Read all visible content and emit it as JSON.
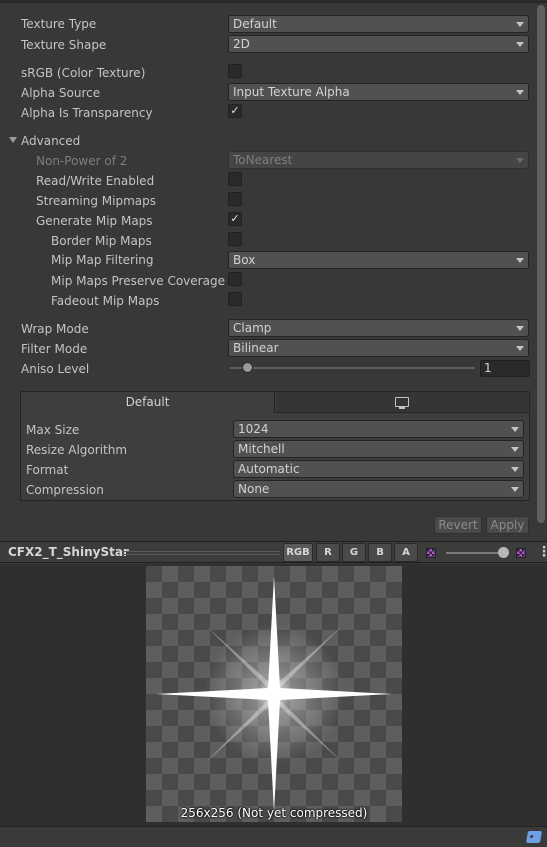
{
  "settings": {
    "texture_type": {
      "label": "Texture Type",
      "value": "Default"
    },
    "texture_shape": {
      "label": "Texture Shape",
      "value": "2D"
    },
    "srgb": {
      "label": "sRGB (Color Texture)",
      "checked": false
    },
    "alpha_source": {
      "label": "Alpha Source",
      "value": "Input Texture Alpha"
    },
    "alpha_is_transparency": {
      "label": "Alpha Is Transparency",
      "checked": true,
      "mark": "✓"
    },
    "advanced": {
      "label": "Advanced",
      "expanded": true
    },
    "non_power_of_2": {
      "label": "Non-Power of 2",
      "value": "ToNearest",
      "disabled": true
    },
    "read_write": {
      "label": "Read/Write Enabled",
      "checked": false
    },
    "streaming_mipmaps": {
      "label": "Streaming Mipmaps",
      "checked": false
    },
    "generate_mip_maps": {
      "label": "Generate Mip Maps",
      "checked": true,
      "mark": "✓"
    },
    "border_mip_maps": {
      "label": "Border Mip Maps",
      "checked": false
    },
    "mip_map_filtering": {
      "label": "Mip Map Filtering",
      "value": "Box"
    },
    "mip_maps_preserve_coverage": {
      "label": "Mip Maps Preserve Coverage",
      "checked": false
    },
    "fadeout_mip_maps": {
      "label": "Fadeout Mip Maps",
      "checked": false
    },
    "wrap_mode": {
      "label": "Wrap Mode",
      "value": "Clamp"
    },
    "filter_mode": {
      "label": "Filter Mode",
      "value": "Bilinear"
    },
    "aniso_level": {
      "label": "Aniso Level",
      "value": "1",
      "slider_fraction": 0.07
    }
  },
  "platform": {
    "tabs": [
      {
        "label": "Default",
        "selected": true
      },
      {
        "icon": "monitor-icon",
        "selected": false
      }
    ],
    "max_size": {
      "label": "Max Size",
      "value": "1024"
    },
    "resize_algorithm": {
      "label": "Resize Algorithm",
      "value": "Mitchell"
    },
    "format": {
      "label": "Format",
      "value": "Automatic"
    },
    "compression": {
      "label": "Compression",
      "value": "None"
    }
  },
  "actions": {
    "revert": "Revert",
    "apply": "Apply"
  },
  "preview": {
    "title": "CFX2_T_ShinyStar",
    "channels": [
      "RGB",
      "R",
      "G",
      "B",
      "A"
    ],
    "active_channel": "RGB",
    "mip_level_fraction": 1.0,
    "caption": "256x256 (Not yet compressed)"
  },
  "colors": {
    "background": "#383838",
    "field": "#515151",
    "checkbox": "#2a2a2a",
    "accent_mip": "#b04fd6",
    "tag_blue": "#6fa0e6"
  }
}
